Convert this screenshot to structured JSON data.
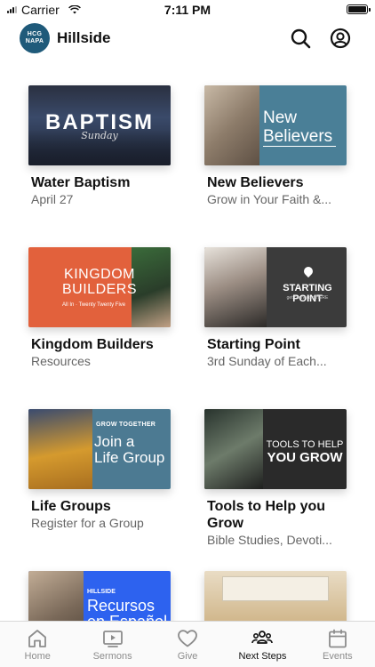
{
  "status": {
    "carrier": "Carrier",
    "time": "7:11 PM",
    "battery_level": 1.0
  },
  "header": {
    "logo_text": "HCG NAPA",
    "title": "Hillside",
    "search_icon": "search-icon",
    "account_icon": "account-icon"
  },
  "cards": [
    {
      "title": "Water Baptism",
      "subtitle": "April 27",
      "thumb": {
        "word": "BAPTISM",
        "script": "Sunday"
      }
    },
    {
      "title": "New Believers",
      "subtitle": "Grow in Your Faith &...",
      "thumb": {
        "line1": "New",
        "line2": "Believers"
      }
    },
    {
      "title": "Kingdom Builders",
      "subtitle": "Resources",
      "thumb": {
        "line1": "KINGDOM",
        "line2": "BUILDERS",
        "small": "All In · Twenty Twenty Five"
      }
    },
    {
      "title": "Starting Point",
      "subtitle": "3rd Sunday of Each...",
      "thumb": {
        "word": "STARTING POINT",
        "small": "get connected HERE"
      }
    },
    {
      "title": "Life Groups",
      "subtitle": "Register for a Group",
      "thumb": {
        "kicker": "GROW TOGETHER",
        "line1": "Join a",
        "line2": "Life Group"
      }
    },
    {
      "title": "Tools to Help you Grow",
      "subtitle": "Bible Studies, Devoti...",
      "thumb": {
        "line1": "TOOLS TO HELP",
        "line2": "YOU GROW"
      }
    },
    {
      "title": "",
      "subtitle": "",
      "thumb": {
        "kicker": "HILLSIDE",
        "line1": "Recursos",
        "line2": "en Español"
      }
    },
    {
      "title": "",
      "subtitle": "",
      "thumb": {}
    }
  ],
  "tabs": [
    {
      "label": "Home",
      "icon": "home-icon",
      "active": false
    },
    {
      "label": "Sermons",
      "icon": "video-icon",
      "active": false
    },
    {
      "label": "Give",
      "icon": "heart-icon",
      "active": false
    },
    {
      "label": "Next Steps",
      "icon": "people-icon",
      "active": true
    },
    {
      "label": "Events",
      "icon": "calendar-icon",
      "active": false
    }
  ],
  "colors": {
    "active_tab": "#111111",
    "inactive_tab": "#8c8c8c",
    "logo_bg": "#1f5a7a"
  }
}
